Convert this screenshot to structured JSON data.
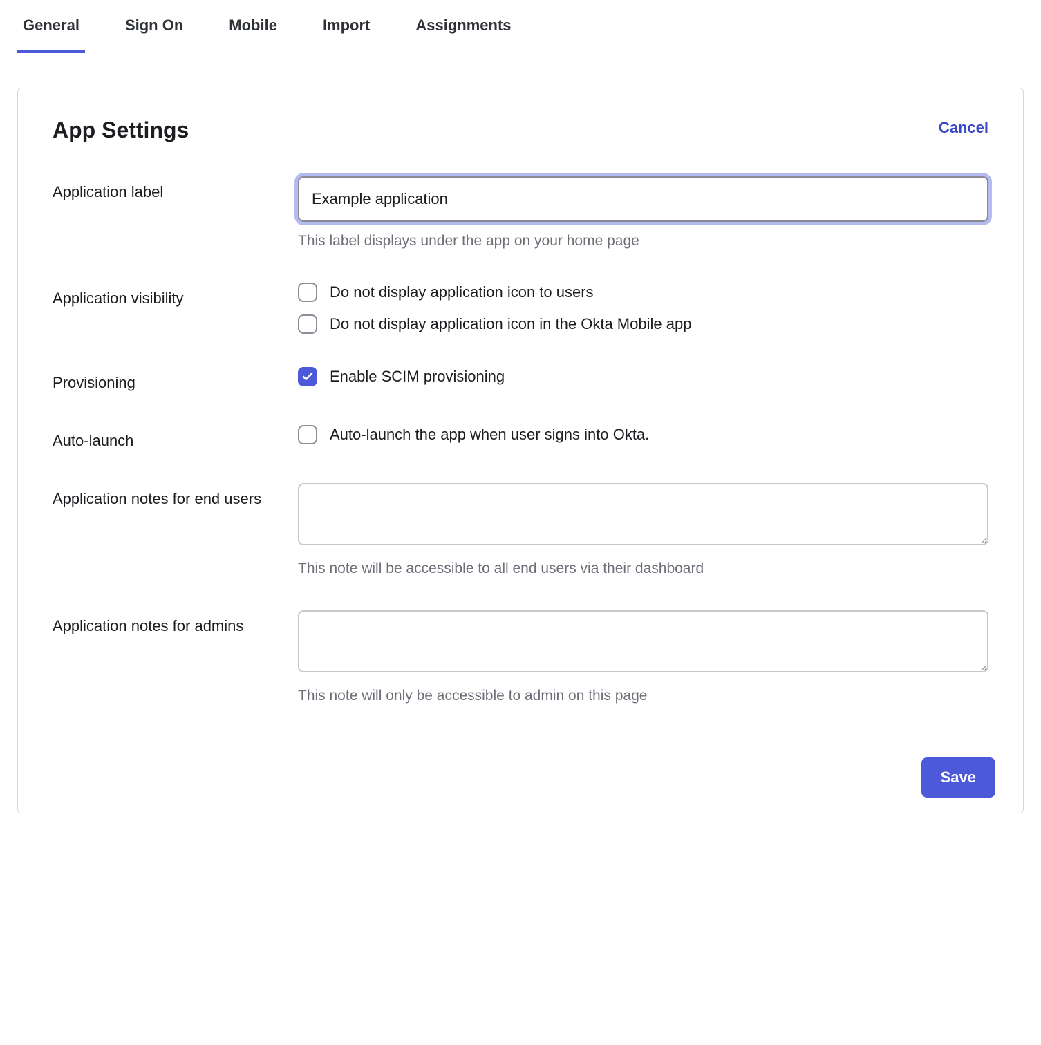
{
  "tabs": [
    {
      "label": "General",
      "active": true
    },
    {
      "label": "Sign On",
      "active": false
    },
    {
      "label": "Mobile",
      "active": false
    },
    {
      "label": "Import",
      "active": false
    },
    {
      "label": "Assignments",
      "active": false
    }
  ],
  "panel": {
    "title": "App Settings",
    "cancel_label": "Cancel",
    "save_label": "Save"
  },
  "fields": {
    "app_label": {
      "label": "Application label",
      "value": "Example application",
      "help": "This label displays under the app on your home page"
    },
    "visibility": {
      "label": "Application visibility",
      "options": [
        {
          "label": "Do not display application icon to users",
          "checked": false
        },
        {
          "label": "Do not display application icon in the Okta Mobile app",
          "checked": false
        }
      ]
    },
    "provisioning": {
      "label": "Provisioning",
      "options": [
        {
          "label": "Enable SCIM provisioning",
          "checked": true
        }
      ]
    },
    "autolaunch": {
      "label": "Auto-launch",
      "options": [
        {
          "label": "Auto-launch the app when user signs into Okta.",
          "checked": false
        }
      ]
    },
    "notes_end_users": {
      "label": "Application notes for end users",
      "value": "",
      "help": "This note will be accessible to all end users via their dashboard"
    },
    "notes_admins": {
      "label": "Application notes for admins",
      "value": "",
      "help": "This note will only be accessible to admin on this page"
    }
  }
}
